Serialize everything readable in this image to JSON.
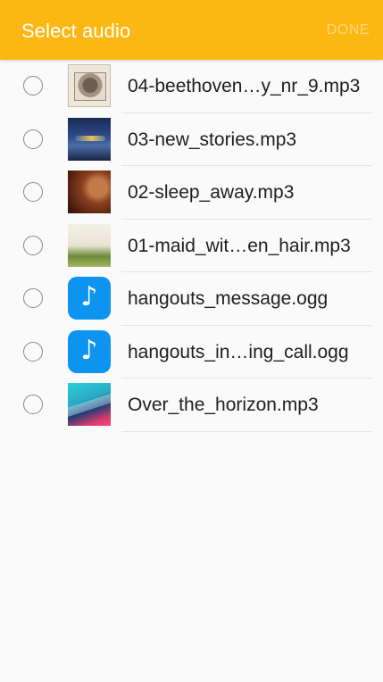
{
  "appbar": {
    "title": "Select audio",
    "done_label": "DONE",
    "background_color": "#fdb713"
  },
  "items": [
    {
      "label": "04-beethoven…y_nr_9.mp3",
      "thumb": "album-art",
      "selected": false
    },
    {
      "label": "03-new_stories.mp3",
      "thumb": "album-art",
      "selected": false
    },
    {
      "label": "02-sleep_away.mp3",
      "thumb": "album-art",
      "selected": false
    },
    {
      "label": "01-maid_wit…en_hair.mp3",
      "thumb": "album-art",
      "selected": false
    },
    {
      "label": "hangouts_message.ogg",
      "thumb": "music-note-icon",
      "selected": false
    },
    {
      "label": "hangouts_in…ing_call.ogg",
      "thumb": "music-note-icon",
      "selected": false
    },
    {
      "label": "Over_the_horizon.mp3",
      "thumb": "album-art",
      "selected": false
    }
  ]
}
